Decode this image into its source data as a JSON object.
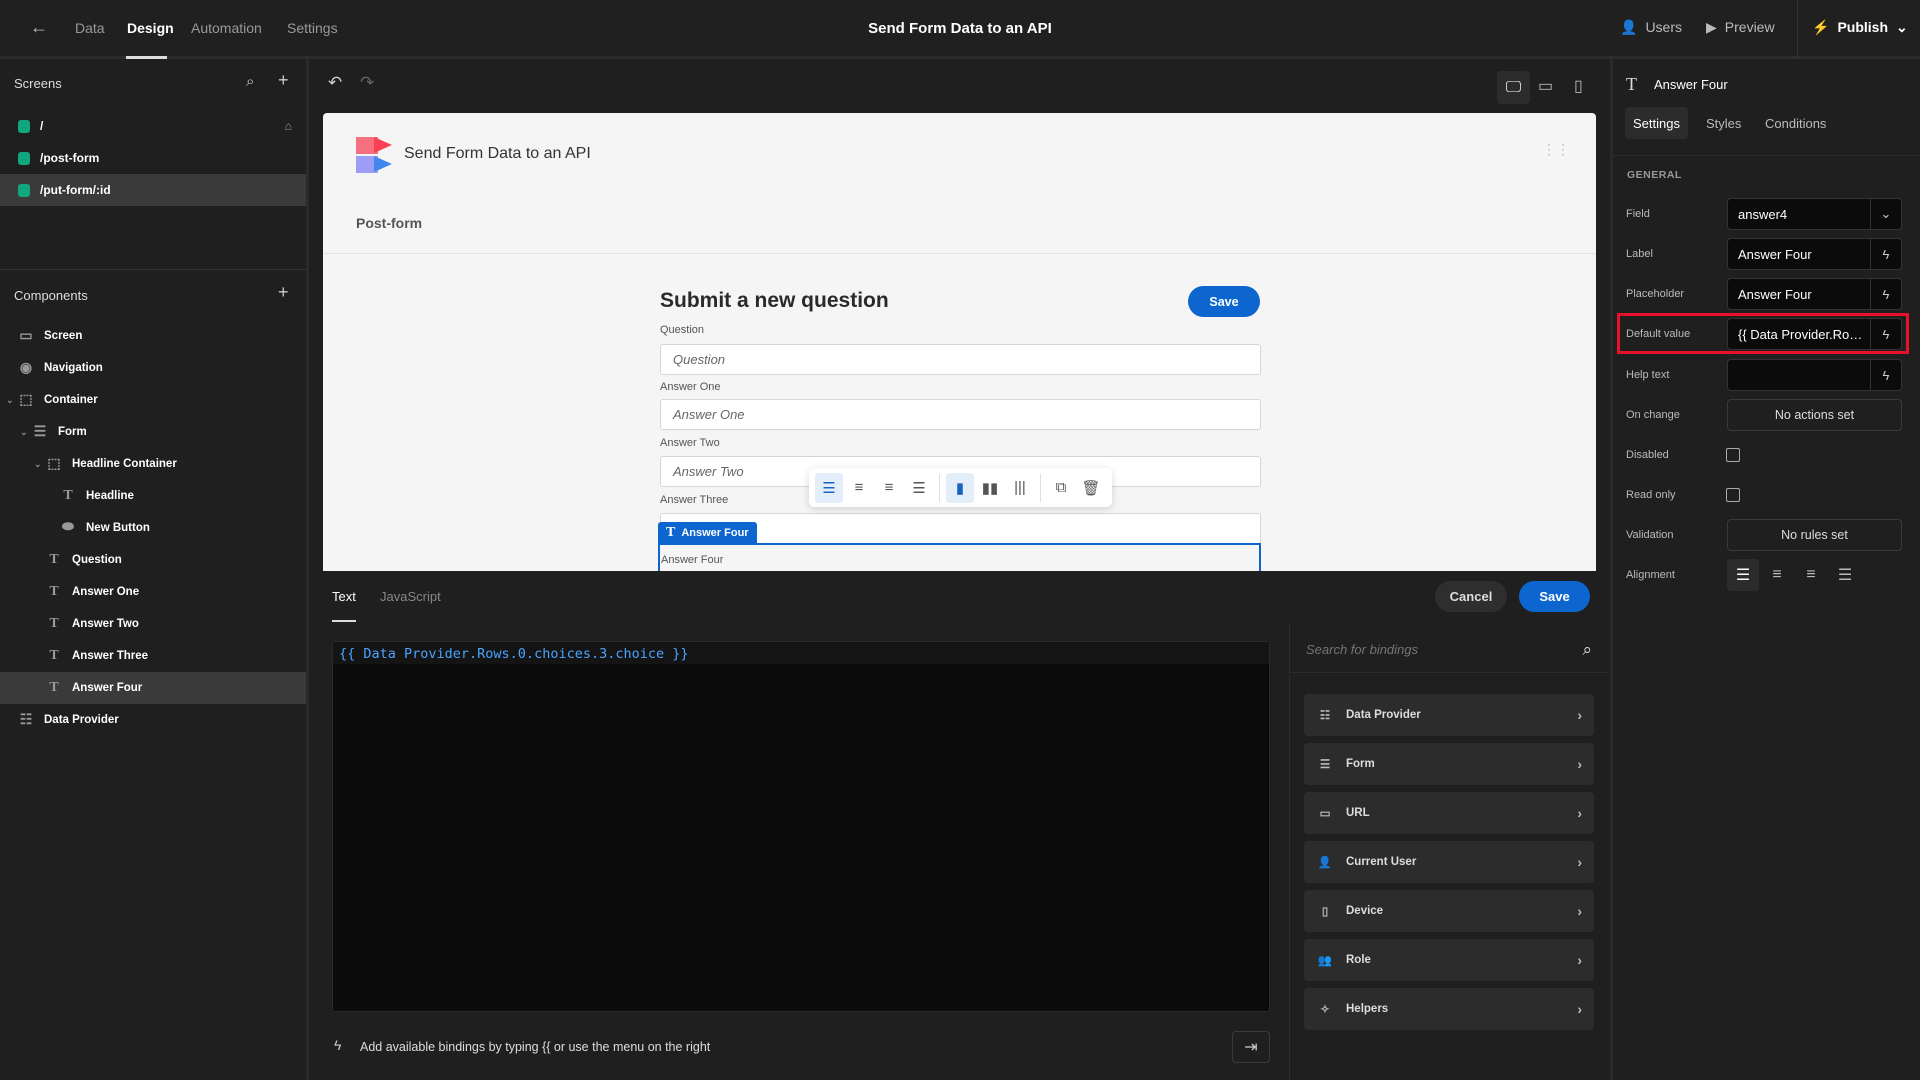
{
  "topbar": {
    "nav": [
      "Data",
      "Design",
      "Automation",
      "Settings"
    ],
    "title": "Send Form Data to an API",
    "users": "Users",
    "preview": "Preview",
    "publish": "Publish"
  },
  "screens": {
    "header": "Screens",
    "items": [
      "/",
      "/post-form",
      "/put-form/:id"
    ]
  },
  "components": {
    "header": "Components",
    "items": [
      "Screen",
      "Navigation",
      "Container",
      "Form",
      "Headline Container",
      "Headline",
      "New Button",
      "Question",
      "Answer One",
      "Answer Two",
      "Answer Three",
      "Answer Four",
      "Data Provider"
    ]
  },
  "canvas": {
    "app_title": "Send Form Data to an API",
    "nav_link": "Post-form",
    "form_title": "Submit a new question",
    "save": "Save",
    "fields": [
      {
        "label": "Question",
        "placeholder": "Question"
      },
      {
        "label": "Answer One",
        "placeholder": "Answer One"
      },
      {
        "label": "Answer Two",
        "placeholder": "Answer Two"
      },
      {
        "label": "Answer Three",
        "placeholder": ""
      }
    ],
    "selected_tag": "Answer Four",
    "selected_label": "Answer Four"
  },
  "editor": {
    "tabs": [
      "Text",
      "JavaScript"
    ],
    "cancel": "Cancel",
    "save": "Save",
    "code": "{{ Data Provider.Rows.0.choices.3.choice }}",
    "hint": "Add available bindings by typing {{ or use the menu on the right",
    "search_placeholder": "Search for bindings",
    "bindings": [
      "Data Provider",
      "Form",
      "URL",
      "Current User",
      "Device",
      "Role",
      "Helpers"
    ]
  },
  "settings": {
    "component": "Answer Four",
    "tabs": [
      "Settings",
      "Styles",
      "Conditions"
    ],
    "section": "GENERAL",
    "field_label": "Field",
    "field": "answer4",
    "label_label": "Label",
    "label": "Answer Four",
    "placeholder_label": "Placeholder",
    "placeholder": "Answer Four",
    "default_label": "Default value",
    "default": "{{ Data Provider.Ro…",
    "help_label": "Help text",
    "help": "",
    "onchange_label": "On change",
    "onchange": "No actions set",
    "disabled_label": "Disabled",
    "disabled": false,
    "readonly_label": "Read only",
    "readonly": false,
    "validation_label": "Validation",
    "validation": "No rules set",
    "alignment_label": "Alignment",
    "alignment": "left"
  },
  "colors": {
    "accent": "#0d66d0",
    "highlight": "#e8102a",
    "screen_dot": "#12a67e"
  }
}
